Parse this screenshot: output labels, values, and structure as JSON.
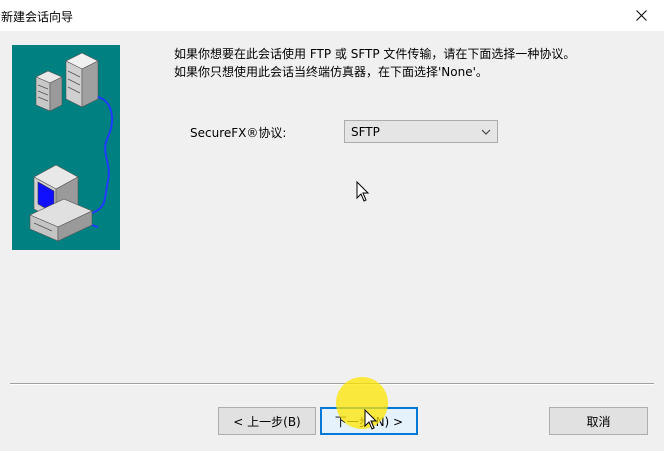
{
  "window": {
    "title": "新建会话向导",
    "close_icon": "close-icon"
  },
  "wizard": {
    "description_line1": "如果你想要在此会话使用 FTP 或 SFTP 文件传输，请在下面选择一种协议。",
    "description_line2": "如果你只想使用此会话当终端仿真器，在下面选择'None'。",
    "protocol_label": "SecureFX®协议:",
    "protocol_selected": "SFTP"
  },
  "buttons": {
    "back": "< 上一步(B)",
    "next": "下一步(N) >",
    "cancel": "取消"
  },
  "colors": {
    "graphic_bg": "#008080",
    "focus_border": "#0078d7",
    "click_highlight": "#ffe600"
  }
}
